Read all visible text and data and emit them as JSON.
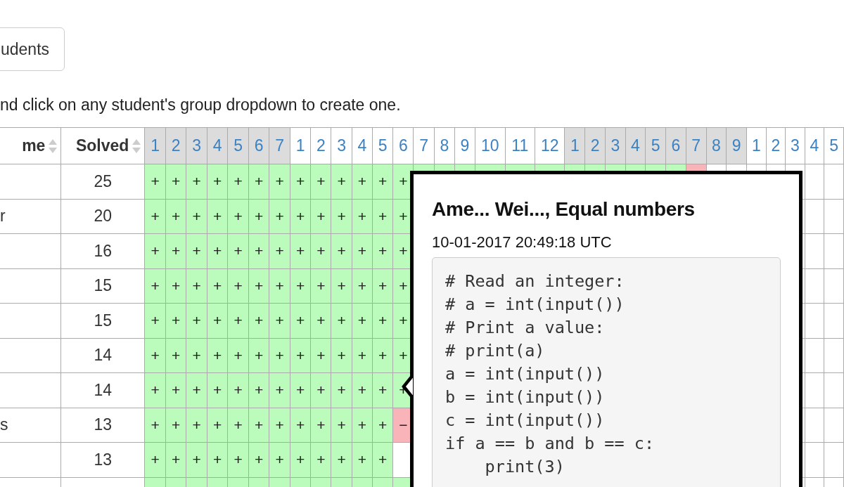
{
  "students_button": {
    "label": "udents"
  },
  "hint": "nd click on any student's group dropdown to create one.",
  "table": {
    "name_header": "me",
    "solved_header": "Solved",
    "problem_groups": [
      {
        "shaded": true,
        "problems": [
          "1",
          "2",
          "3",
          "4",
          "5",
          "6",
          "7"
        ]
      },
      {
        "shaded": false,
        "problems": [
          "1",
          "2",
          "3",
          "4",
          "5",
          "6",
          "7",
          "8",
          "9",
          "10",
          "11",
          "12"
        ]
      },
      {
        "shaded": true,
        "problems": [
          "1",
          "2",
          "3",
          "4",
          "5",
          "6",
          "7",
          "8",
          "9"
        ]
      },
      {
        "shaded": false,
        "problems": [
          "1",
          "2",
          "3",
          "4",
          "5"
        ]
      }
    ],
    "rows": [
      {
        "solved": "25",
        "cells": [
          {
            "mark": "+",
            "color": "#bbfbbb"
          },
          {
            "mark": "+",
            "color": "#bbfbbb"
          },
          {
            "mark": "+",
            "color": "#bbfbbb"
          },
          {
            "mark": "+",
            "color": "#bbfbbb"
          },
          {
            "mark": "+",
            "color": "#bbfbbb"
          },
          {
            "mark": "+",
            "color": "#bbfbbb"
          },
          {
            "mark": "+",
            "color": "#bbfbbb"
          },
          {
            "mark": "+",
            "color": "#bbfbbb"
          },
          {
            "mark": "+",
            "color": "#bbfbbb"
          },
          {
            "mark": "+",
            "color": "#bbfbbb"
          },
          {
            "mark": "+",
            "color": "#bbfbbb"
          },
          {
            "mark": "+",
            "color": "#bbfbbb"
          },
          {
            "mark": "+",
            "color": "#bbfbbb"
          },
          {
            "color": "#bbfbbb"
          },
          {
            "color": "#bbfbbb"
          },
          {
            "color": "#bbfbbb"
          },
          {
            "color": "#bbfbbb"
          },
          {
            "color": "#bbfbbb"
          },
          {
            "color": "#bbfbbb"
          },
          {
            "color": "#bbfbbb"
          },
          {
            "color": "#bbfbbb"
          },
          {
            "color": "#bbfbbb"
          },
          {
            "color": "#bbfbbb"
          },
          {
            "color": "#bbfbbb"
          },
          {
            "color": "#bbfbbb"
          },
          {
            "color": "#f8b4b8"
          },
          {
            "color": "#ffffff"
          },
          {
            "color": "#ffffff"
          },
          {
            "color": "#ffffff"
          },
          {
            "color": "#ffffff"
          },
          {
            "color": "#ffffff"
          }
        ],
        "right_cells": [
          {
            "color": "#ffffff"
          },
          {
            "color": "#ffffff"
          }
        ]
      },
      {
        "name": "r",
        "solved": "20",
        "cells": [
          {
            "mark": "+",
            "color": "#bbfbbb"
          },
          {
            "mark": "+",
            "color": "#bbfbbb"
          },
          {
            "mark": "+",
            "color": "#bbfbbb"
          },
          {
            "mark": "+",
            "color": "#bbfbbb"
          },
          {
            "mark": "+",
            "color": "#bbfbbb"
          },
          {
            "mark": "+",
            "color": "#bbfbbb"
          },
          {
            "mark": "+",
            "color": "#bbfbbb"
          },
          {
            "mark": "+",
            "color": "#bbfbbb"
          },
          {
            "mark": "+",
            "color": "#bbfbbb"
          },
          {
            "mark": "+",
            "color": "#bbfbbb"
          },
          {
            "mark": "+",
            "color": "#bbfbbb"
          },
          {
            "mark": "+",
            "color": "#bbfbbb"
          },
          {
            "mark": "+",
            "color": "#bbfbbb"
          }
        ],
        "right_cells": [
          {
            "color": "#ffffff"
          },
          {
            "color": "#ffffff"
          }
        ]
      },
      {
        "solved": "16",
        "cells": [
          {
            "mark": "+",
            "color": "#bbfbbb"
          },
          {
            "mark": "+",
            "color": "#bbfbbb"
          },
          {
            "mark": "+",
            "color": "#bbfbbb"
          },
          {
            "mark": "+",
            "color": "#bbfbbb"
          },
          {
            "mark": "+",
            "color": "#bbfbbb"
          },
          {
            "mark": "+",
            "color": "#bbfbbb"
          },
          {
            "mark": "+",
            "color": "#bbfbbb"
          },
          {
            "mark": "+",
            "color": "#bbfbbb"
          },
          {
            "mark": "+",
            "color": "#bbfbbb"
          },
          {
            "mark": "+",
            "color": "#bbfbbb"
          },
          {
            "mark": "+",
            "color": "#bbfbbb"
          },
          {
            "mark": "+",
            "color": "#bbfbbb"
          },
          {
            "mark": "+",
            "color": "#bbfbbb"
          }
        ],
        "right_cells": [
          {
            "color": "#ffffff"
          },
          {
            "color": "#ffffff"
          }
        ]
      },
      {
        "solved": "15",
        "cells": [
          {
            "mark": "+",
            "color": "#bbfbbb"
          },
          {
            "mark": "+",
            "color": "#bbfbbb"
          },
          {
            "mark": "+",
            "color": "#bbfbbb"
          },
          {
            "mark": "+",
            "color": "#bbfbbb"
          },
          {
            "mark": "+",
            "color": "#bbfbbb"
          },
          {
            "mark": "+",
            "color": "#bbfbbb"
          },
          {
            "mark": "+",
            "color": "#bbfbbb"
          },
          {
            "mark": "+",
            "color": "#bbfbbb"
          },
          {
            "mark": "+",
            "color": "#bbfbbb"
          },
          {
            "mark": "+",
            "color": "#bbfbbb"
          },
          {
            "mark": "+",
            "color": "#bbfbbb"
          },
          {
            "mark": "+",
            "color": "#bbfbbb"
          },
          {
            "mark": "+",
            "color": "#bbfbbb"
          }
        ],
        "right_cells": [
          {
            "color": "#ffffff"
          },
          {
            "color": "#ffffff"
          }
        ]
      },
      {
        "solved": "15",
        "cells": [
          {
            "mark": "+",
            "color": "#bbfbbb"
          },
          {
            "mark": "+",
            "color": "#bbfbbb"
          },
          {
            "mark": "+",
            "color": "#bbfbbb"
          },
          {
            "mark": "+",
            "color": "#bbfbbb"
          },
          {
            "mark": "+",
            "color": "#bbfbbb"
          },
          {
            "mark": "+",
            "color": "#bbfbbb"
          },
          {
            "mark": "+",
            "color": "#bbfbbb"
          },
          {
            "mark": "+",
            "color": "#bbfbbb"
          },
          {
            "mark": "+",
            "color": "#bbfbbb"
          },
          {
            "mark": "+",
            "color": "#bbfbbb"
          },
          {
            "mark": "+",
            "color": "#bbfbbb"
          },
          {
            "mark": "+",
            "color": "#bbfbbb"
          },
          {
            "mark": "+",
            "color": "#bbfbbb"
          }
        ],
        "right_cells": [
          {
            "color": "#ffffff"
          },
          {
            "color": "#ffffff"
          }
        ]
      },
      {
        "solved": "14",
        "cells": [
          {
            "mark": "+",
            "color": "#bbfbbb"
          },
          {
            "mark": "+",
            "color": "#bbfbbb"
          },
          {
            "mark": "+",
            "color": "#bbfbbb"
          },
          {
            "mark": "+",
            "color": "#bbfbbb"
          },
          {
            "mark": "+",
            "color": "#bbfbbb"
          },
          {
            "mark": "+",
            "color": "#bbfbbb"
          },
          {
            "mark": "+",
            "color": "#bbfbbb"
          },
          {
            "mark": "+",
            "color": "#bbfbbb"
          },
          {
            "mark": "+",
            "color": "#bbfbbb"
          },
          {
            "mark": "+",
            "color": "#bbfbbb"
          },
          {
            "mark": "+",
            "color": "#bbfbbb"
          },
          {
            "mark": "+",
            "color": "#bbfbbb"
          },
          {
            "mark": "+",
            "color": "#bbfbbb"
          }
        ],
        "right_cells": [
          {
            "color": "#ffffff"
          },
          {
            "color": "#ffffff"
          }
        ]
      },
      {
        "solved": "14",
        "cells": [
          {
            "mark": "+",
            "color": "#bbfbbb"
          },
          {
            "mark": "+",
            "color": "#bbfbbb"
          },
          {
            "mark": "+",
            "color": "#bbfbbb"
          },
          {
            "mark": "+",
            "color": "#bbfbbb"
          },
          {
            "mark": "+",
            "color": "#bbfbbb"
          },
          {
            "mark": "+",
            "color": "#bbfbbb"
          },
          {
            "mark": "+",
            "color": "#bbfbbb"
          },
          {
            "mark": "+",
            "color": "#bbfbbb"
          },
          {
            "mark": "+",
            "color": "#bbfbbb"
          },
          {
            "mark": "+",
            "color": "#bbfbbb"
          },
          {
            "mark": "+",
            "color": "#bbfbbb"
          },
          {
            "mark": "+",
            "color": "#bbfbbb"
          },
          {
            "mark": "+",
            "color": "#bbfbbb"
          }
        ],
        "right_cells": [
          {
            "color": "#ffffff"
          },
          {
            "color": "#ffffff"
          }
        ]
      },
      {
        "name": "s",
        "solved": "13",
        "cells": [
          {
            "mark": "+",
            "color": "#bbfbbb"
          },
          {
            "mark": "+",
            "color": "#bbfbbb"
          },
          {
            "mark": "+",
            "color": "#bbfbbb"
          },
          {
            "mark": "+",
            "color": "#bbfbbb"
          },
          {
            "mark": "+",
            "color": "#bbfbbb"
          },
          {
            "mark": "+",
            "color": "#bbfbbb"
          },
          {
            "mark": "+",
            "color": "#bbfbbb"
          },
          {
            "mark": "+",
            "color": "#bbfbbb"
          },
          {
            "mark": "+",
            "color": "#bbfbbb"
          },
          {
            "mark": "+",
            "color": "#bbfbbb"
          },
          {
            "mark": "+",
            "color": "#bbfbbb"
          },
          {
            "mark": "+",
            "color": "#bbfbbb"
          },
          {
            "mark": "−",
            "color": "#f8b4b8"
          }
        ],
        "right_cells": [
          {
            "color": "#ffffff"
          },
          {
            "color": "#ffffff"
          }
        ]
      },
      {
        "solved": "13",
        "cells": [
          {
            "mark": "+",
            "color": "#bbfbbb"
          },
          {
            "mark": "+",
            "color": "#bbfbbb"
          },
          {
            "mark": "+",
            "color": "#bbfbbb"
          },
          {
            "mark": "+",
            "color": "#bbfbbb"
          },
          {
            "mark": "+",
            "color": "#bbfbbb"
          },
          {
            "mark": "+",
            "color": "#bbfbbb"
          },
          {
            "mark": "+",
            "color": "#bbfbbb"
          },
          {
            "mark": "+",
            "color": "#bbfbbb"
          },
          {
            "mark": "+",
            "color": "#bbfbbb"
          },
          {
            "mark": "+",
            "color": "#bbfbbb"
          },
          {
            "mark": "+",
            "color": "#bbfbbb"
          },
          {
            "mark": "+",
            "color": "#bbfbbb"
          },
          {
            "color": "#ffffff"
          }
        ],
        "right_cells": [
          {
            "color": "#ffffff"
          },
          {
            "color": "#ffffff"
          }
        ]
      },
      {
        "cells": [
          {
            "color": "#bbfbbb"
          },
          {
            "color": "#bbfbbb"
          },
          {
            "color": "#bbfbbb"
          },
          {
            "color": "#bbfbbb"
          },
          {
            "color": "#bbfbbb"
          },
          {
            "color": "#bbfbbb"
          },
          {
            "color": "#bbfbbb"
          },
          {
            "color": "#bbfbbb"
          },
          {
            "color": "#bbfbbb"
          },
          {
            "color": "#bbfbbb"
          },
          {
            "color": "#bbfbbb"
          },
          {
            "color": "#bbfbbb"
          },
          {
            "color": "#bbfbbb"
          }
        ],
        "right_cells": [
          {
            "color": "#ffffff"
          },
          {
            "color": "#ffffff"
          }
        ]
      }
    ]
  },
  "popover": {
    "title": "Ame... Wei..., Equal numbers",
    "time": "10-01-2017 20:49:18 UTC",
    "code": [
      "# Read an integer:",
      "# a = int(input())",
      "# Print a value:",
      "# print(a)",
      "a = int(input())",
      "b = int(input())",
      "c = int(input())",
      "if a == b and b == c:",
      "    print(3)"
    ]
  }
}
